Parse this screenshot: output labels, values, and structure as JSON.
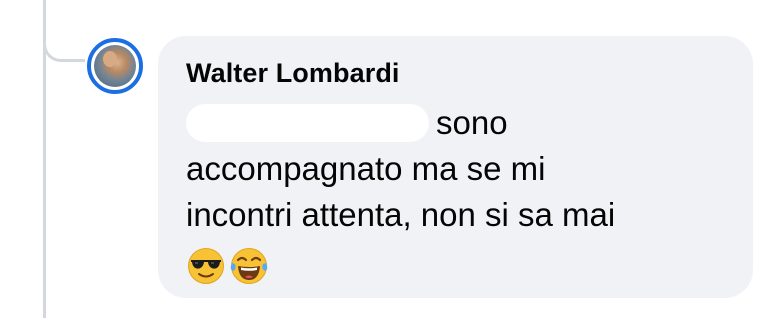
{
  "comment": {
    "author": "Walter Lombardi",
    "text_line_1": "sono",
    "text_line_2": "accompagnato ma se mi",
    "text_line_3": "incontri attenta, non si sa mai",
    "emojis": [
      "sunglasses-face",
      "tears-of-joy-face"
    ]
  },
  "colors": {
    "bubble_background": "#f0f2f5",
    "avatar_ring": "#1b6fe3",
    "thread_line": "#d4d7dc",
    "text": "#050505"
  }
}
